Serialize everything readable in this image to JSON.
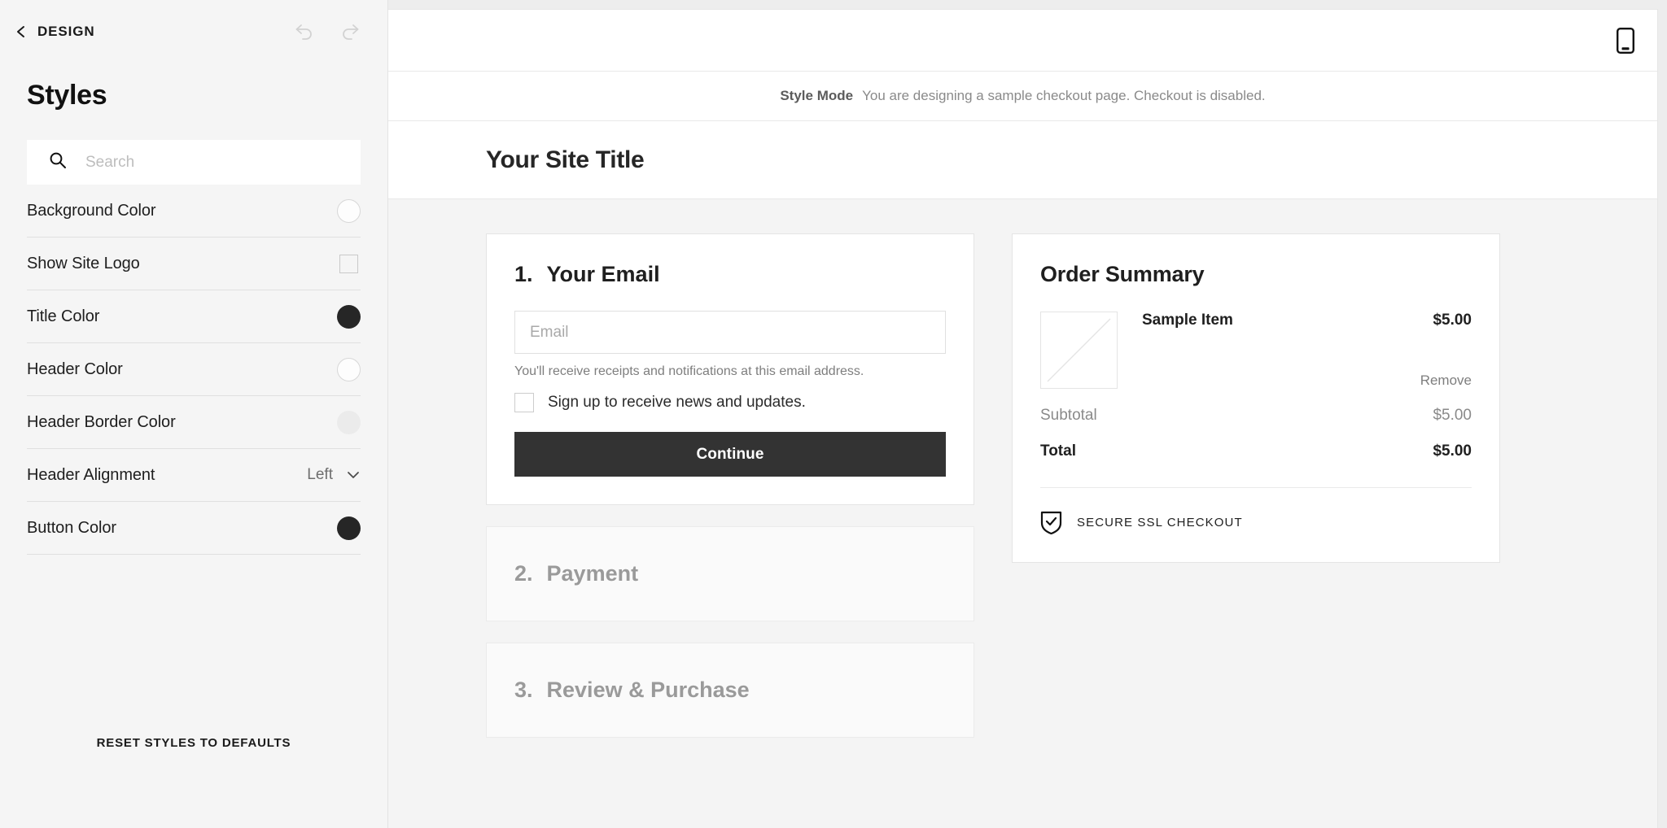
{
  "sidebar": {
    "back_label": "DESIGN",
    "panel_title": "Styles",
    "search_placeholder": "Search",
    "search_value": "",
    "style_rows": [
      {
        "label": "Background Color",
        "control": "swatch",
        "swatch": "#fdfdfd"
      },
      {
        "label": "Show Site Logo",
        "control": "checkbox",
        "checked": false
      },
      {
        "label": "Title Color",
        "control": "swatch",
        "swatch": "#262626"
      },
      {
        "label": "Header Color",
        "control": "swatch",
        "swatch": "#ffffff"
      },
      {
        "label": "Header Border Color",
        "control": "swatch",
        "swatch": "#ebebeb"
      },
      {
        "label": "Header Alignment",
        "control": "select",
        "value": "Left"
      },
      {
        "label": "Button Color",
        "control": "swatch",
        "swatch": "#262626"
      }
    ],
    "reset_label": "RESET STYLES TO DEFAULTS",
    "icons": {
      "back": "chevron-left-icon",
      "undo": "undo-icon",
      "redo": "redo-icon",
      "search": "search-icon",
      "chevron_down": "chevron-down-icon"
    }
  },
  "preview": {
    "device_toggle_icon": "mobile-device-icon",
    "style_mode": {
      "label": "Style Mode",
      "message": "You are designing a sample checkout page. Checkout is disabled."
    },
    "site_title": "Your Site Title",
    "steps": [
      {
        "num": "1.",
        "title": "Your Email",
        "state": "active"
      },
      {
        "num": "2.",
        "title": "Payment",
        "state": "inactive"
      },
      {
        "num": "3.",
        "title": "Review & Purchase",
        "state": "inactive"
      }
    ],
    "email_step": {
      "input_placeholder": "Email",
      "input_value": "",
      "helper_text": "You'll receive receipts and notifications at this email address.",
      "optin_label": "Sign up to receive news and updates.",
      "optin_checked": false,
      "continue_label": "Continue"
    },
    "order_summary": {
      "title": "Order Summary",
      "item_name": "Sample Item",
      "item_price": "$5.00",
      "remove_label": "Remove",
      "subtotal_label": "Subtotal",
      "subtotal_value": "$5.00",
      "total_label": "Total",
      "total_value": "$5.00",
      "ssl_label": "SECURE SSL CHECKOUT",
      "ssl_icon": "shield-check-icon"
    }
  },
  "colors": {
    "button": "#333333",
    "sidebar_bg": "#f5f5f5",
    "checkout_bg": "#f4f4f4",
    "muted_text": "#9a9a9a"
  }
}
